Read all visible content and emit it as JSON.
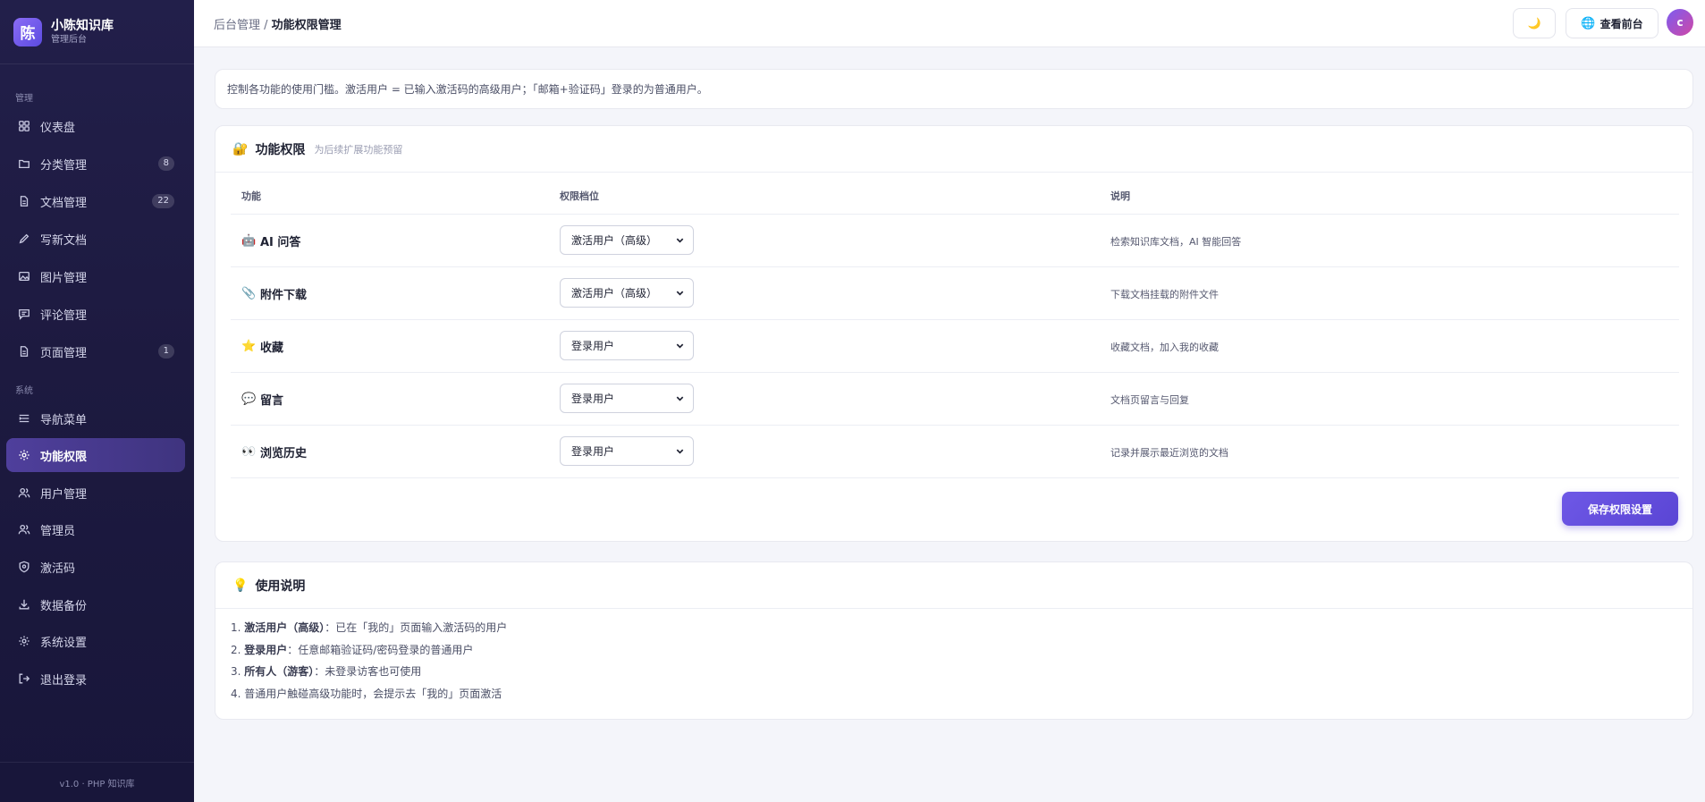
{
  "brand": {
    "logo_char": "陈",
    "title": "小陈知识库",
    "subtitle": "管理后台"
  },
  "sidebar": {
    "group1_label": "管理",
    "group2_label": "系统",
    "items": [
      {
        "label": "仪表盘",
        "icon": "grid-icon",
        "badge": ""
      },
      {
        "label": "分类管理",
        "icon": "folder-icon",
        "badge": "8"
      },
      {
        "label": "文档管理",
        "icon": "file-icon",
        "badge": "22"
      },
      {
        "label": "写新文档",
        "icon": "pen-icon",
        "badge": ""
      },
      {
        "label": "图片管理",
        "icon": "image-icon",
        "badge": ""
      },
      {
        "label": "评论管理",
        "icon": "comment-icon",
        "badge": ""
      },
      {
        "label": "页面管理",
        "icon": "page-icon",
        "badge": "1"
      },
      {
        "label": "导航菜单",
        "icon": "nav-menu-icon",
        "badge": ""
      },
      {
        "label": "功能权限",
        "icon": "gear-icon",
        "badge": "",
        "active": true
      },
      {
        "label": "用户管理",
        "icon": "users-icon",
        "badge": ""
      },
      {
        "label": "管理员",
        "icon": "admin-icon",
        "badge": ""
      },
      {
        "label": "激活码",
        "icon": "shield-icon",
        "badge": ""
      },
      {
        "label": "数据备份",
        "icon": "download-icon",
        "badge": ""
      },
      {
        "label": "系统设置",
        "icon": "settings-icon",
        "badge": ""
      },
      {
        "label": "退出登录",
        "icon": "logout-icon",
        "badge": ""
      }
    ],
    "footer": "v1.0 · PHP 知识库"
  },
  "topbar": {
    "breadcrumb_root": "后台管理",
    "breadcrumb_sep": " / ",
    "breadcrumb_current": "功能权限管理",
    "theme_icon": "🌙",
    "front_icon": "🌐",
    "front_label": "查看前台",
    "avatar_letter": "c"
  },
  "intro": "控制各功能的使用门槛。激活用户 = 已输入激活码的高级用户；「邮箱+验证码」登录的为普通用户。",
  "permissions": {
    "title_icon": "🔐",
    "title": "功能权限",
    "subtitle": "为后续扩展功能预留",
    "headers": {
      "feature": "功能",
      "level": "权限档位",
      "desc": "说明"
    },
    "rows": [
      {
        "icon": "🤖",
        "name": "AI 问答",
        "level": "激活用户（高级）",
        "desc": "检索知识库文档，AI 智能回答"
      },
      {
        "icon": "📎",
        "name": "附件下载",
        "level": "激活用户（高级）",
        "desc": "下载文档挂载的附件文件"
      },
      {
        "icon": "⭐",
        "name": "收藏",
        "level": "登录用户",
        "desc": "收藏文档，加入我的收藏"
      },
      {
        "icon": "💬",
        "name": "留言",
        "level": "登录用户",
        "desc": "文档页留言与回复"
      },
      {
        "icon": "👀",
        "name": "浏览历史",
        "level": "登录用户",
        "desc": "记录并展示最近浏览的文档"
      }
    ],
    "save_label": "保存权限设置"
  },
  "usage": {
    "title_icon": "💡",
    "title": "使用说明",
    "items": [
      {
        "num": "1. ",
        "bold": "激活用户（高级）",
        "text": "：已在「我的」页面输入激活码的用户"
      },
      {
        "num": "2. ",
        "bold": "登录用户",
        "text": "：任意邮箱验证码/密码登录的普通用户"
      },
      {
        "num": "3. ",
        "bold": "所有人（游客）",
        "text": "：未登录访客也可使用"
      },
      {
        "num": "4. ",
        "bold": "",
        "text": "普通用户触碰高级功能时，会提示去「我的」页面激活"
      }
    ]
  }
}
